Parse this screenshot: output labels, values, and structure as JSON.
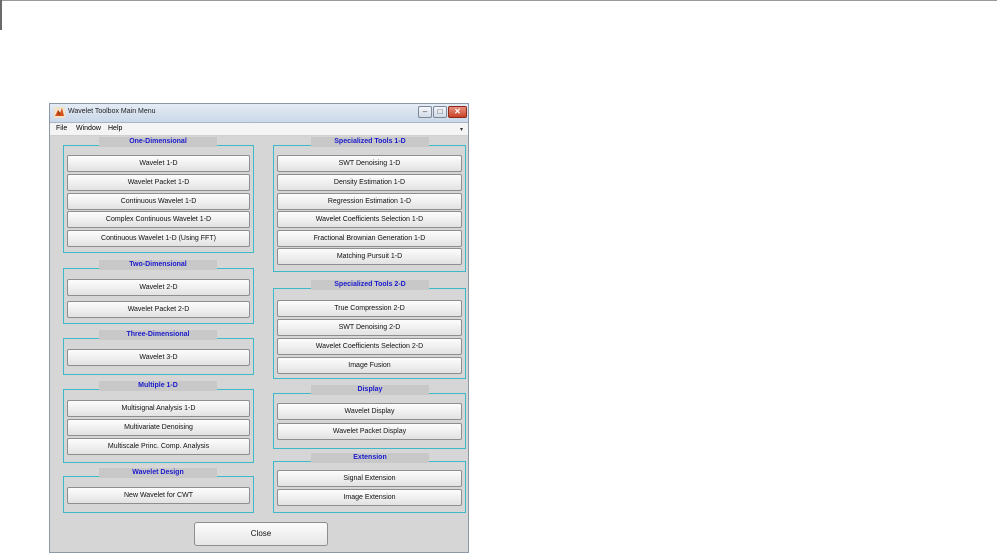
{
  "window": {
    "title": "Wavelet Toolbox Main Menu",
    "icon": "matlab-icon",
    "min_glyph": "–",
    "max_glyph": "□",
    "close_glyph": "✕"
  },
  "menubar": {
    "items": [
      "File",
      "Window",
      "Help"
    ],
    "overflow_glyph": "▾"
  },
  "panels": {
    "one_d": {
      "title": "One-Dimensional",
      "buttons": [
        "Wavelet 1-D",
        "Wavelet Packet 1-D",
        "Continuous Wavelet 1-D",
        "Complex Continuous Wavelet 1-D",
        "Continuous Wavelet 1-D (Using FFT)"
      ]
    },
    "two_d": {
      "title": "Two-Dimensional",
      "buttons": [
        "Wavelet 2-D",
        "Wavelet Packet 2-D"
      ]
    },
    "three_d": {
      "title": "Three-Dimensional",
      "buttons": [
        "Wavelet 3-D"
      ]
    },
    "multiple": {
      "title": "Multiple 1-D",
      "buttons": [
        "Multisignal Analysis 1-D",
        "Multivariate Denoising",
        "Multiscale Princ. Comp. Analysis"
      ]
    },
    "design": {
      "title": "Wavelet Design",
      "buttons": [
        "New Wavelet for CWT"
      ]
    },
    "spec1d": {
      "title": "Specialized Tools 1-D",
      "buttons": [
        "SWT Denoising 1-D",
        "Density Estimation 1-D",
        "Regression Estimation 1-D",
        "Wavelet Coefficients Selection 1-D",
        "Fractional Brownian Generation 1-D",
        "Matching Pursuit 1-D"
      ]
    },
    "spec2d": {
      "title": "Specialized Tools 2-D",
      "buttons": [
        "True Compression 2-D",
        "SWT Denoising 2-D",
        "Wavelet Coefficients Selection 2-D",
        "Image Fusion"
      ]
    },
    "display": {
      "title": "Display",
      "buttons": [
        "Wavelet Display",
        "Wavelet Packet Display"
      ]
    },
    "extension": {
      "title": "Extension",
      "buttons": [
        "Signal Extension",
        "Image Extension"
      ]
    }
  },
  "close_label": "Close",
  "colors": {
    "panel_title": "#1a1acc",
    "panel_border": "#3fb8c8",
    "window_bg": "#d6d6d6"
  }
}
